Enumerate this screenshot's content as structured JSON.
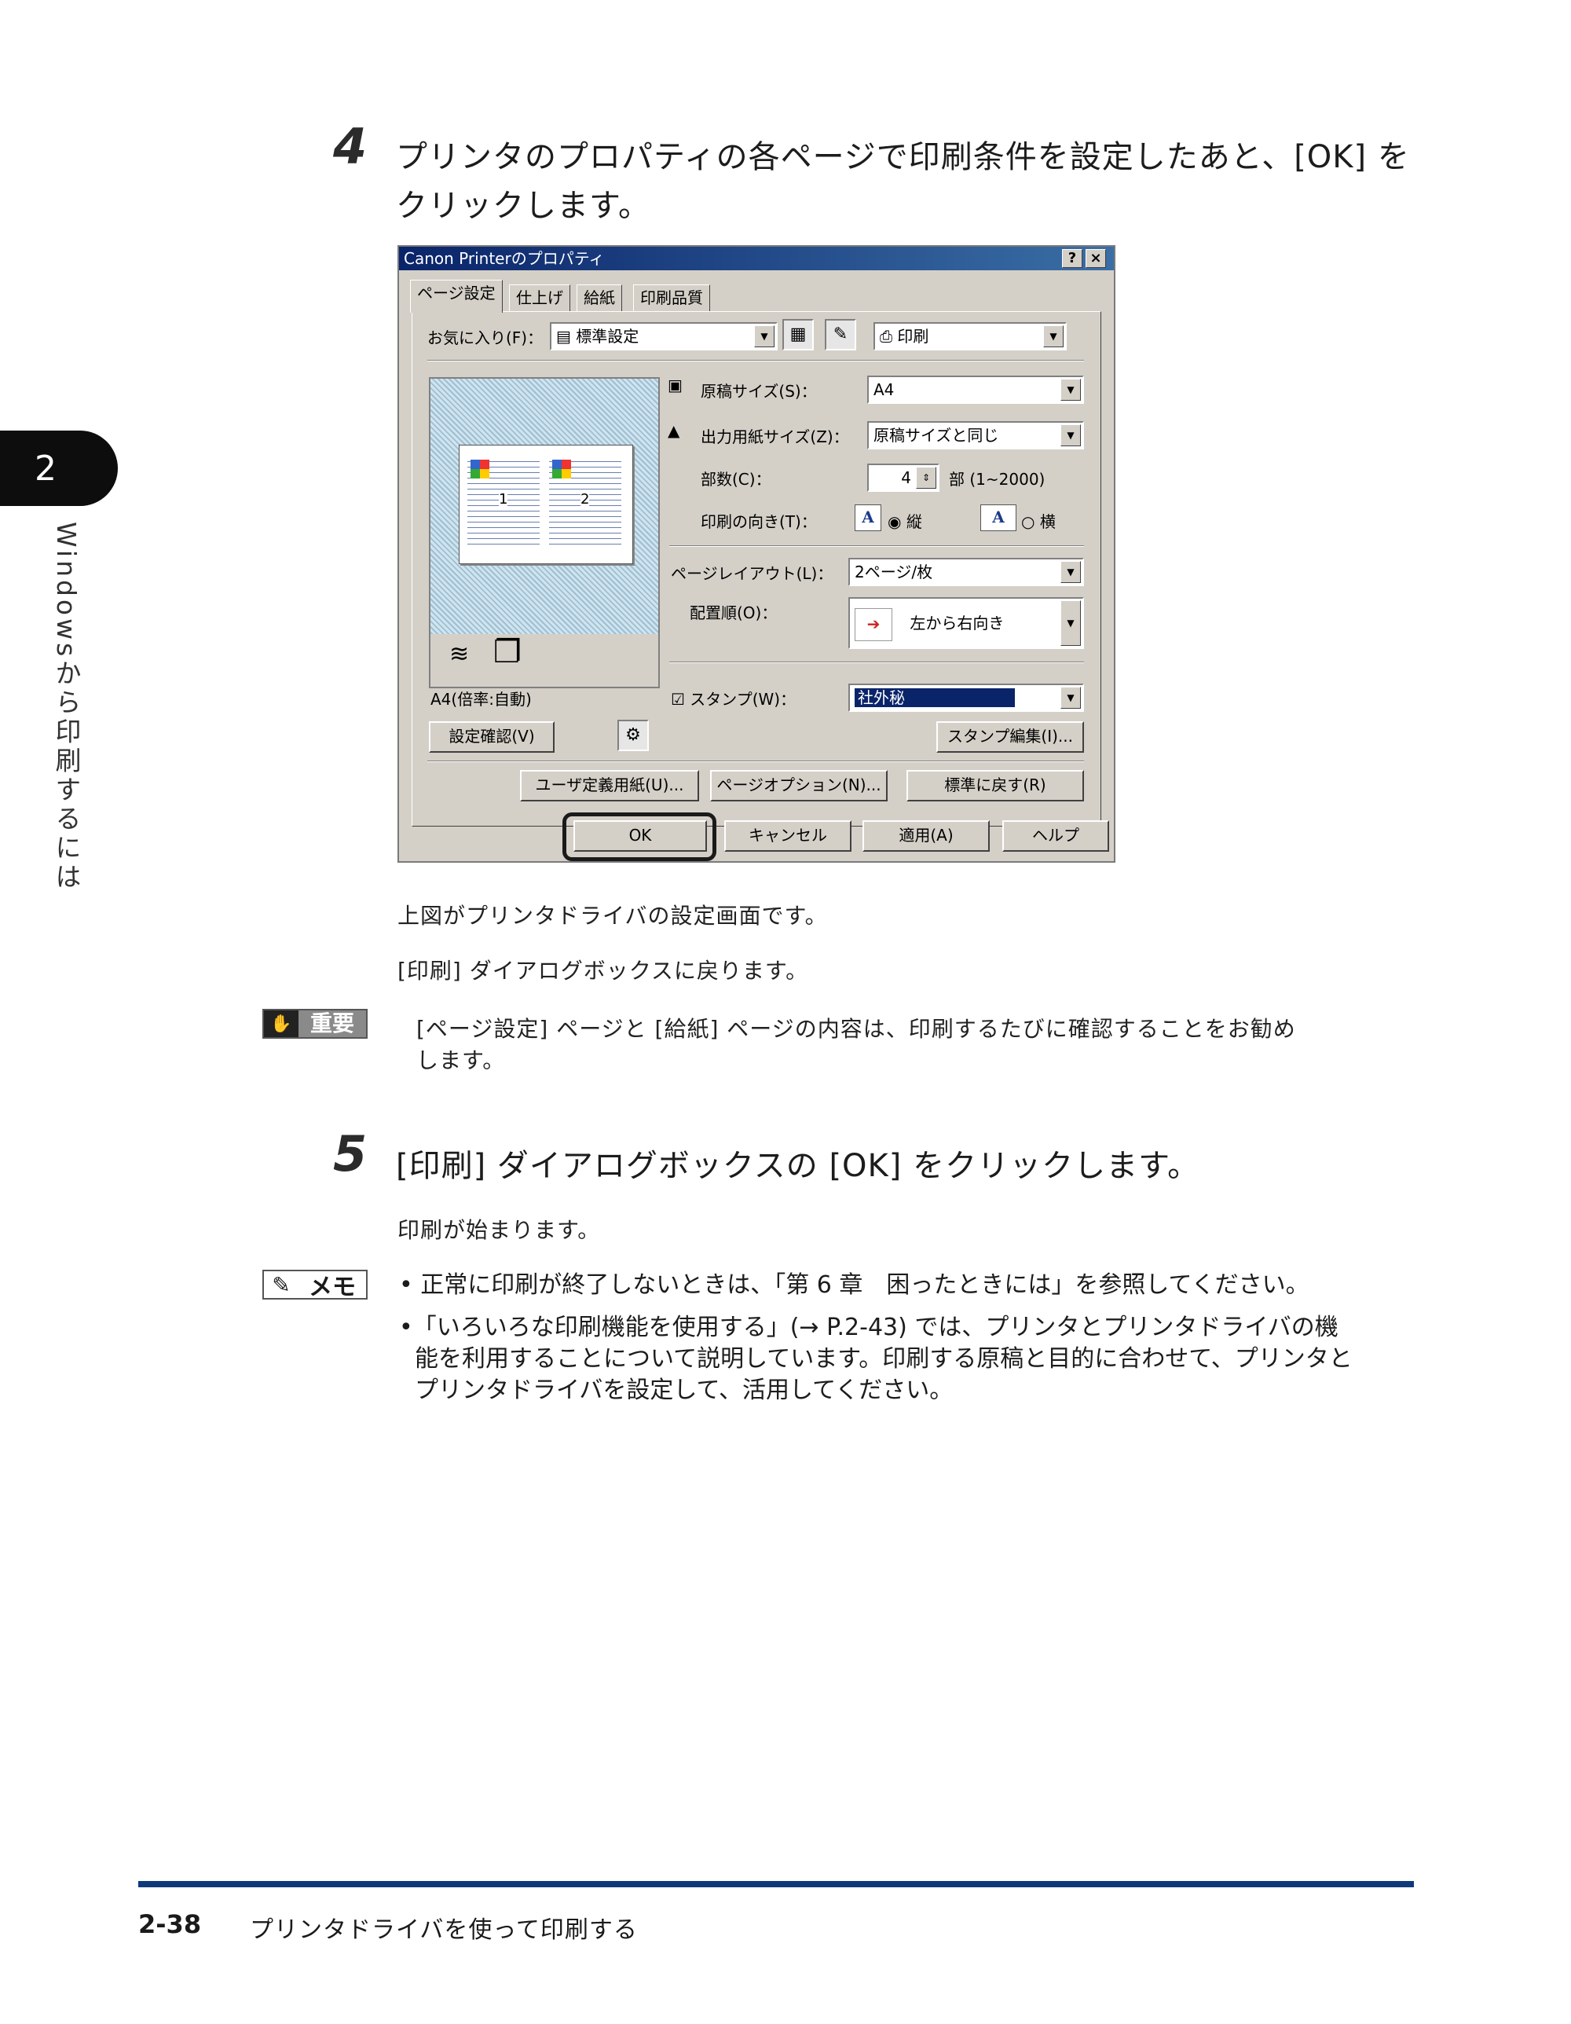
{
  "side": {
    "chapter_num": "2",
    "chapter_title": "Windowsから印刷するには"
  },
  "step4": {
    "number": "4",
    "line1": "プリンタのプロパティの各ページで印刷条件を設定したあと、[OK] を",
    "line2": "クリックします。"
  },
  "dialog": {
    "title": "Canon Printerのプロパティ",
    "help_btn": "?",
    "close_btn": "×",
    "tabs": [
      "ページ設定",
      "仕上げ",
      "給紙",
      "印刷品質"
    ],
    "favorites_label": "お気に入り(F)：",
    "favorites_value": "標準設定",
    "output_value": "印刷",
    "preview_caption": "A4(倍率:自動)",
    "orig_size_label": "原稿サイズ(S)：",
    "orig_size_value": "A4",
    "out_size_label": "出力用紙サイズ(Z)：",
    "out_size_value": "原稿サイズと同じ",
    "copies_label": "部数(C)：",
    "copies_value": "4",
    "copies_unit": "部 (1~2000)",
    "orientation_label": "印刷の向き(T)：",
    "portrait": "縦",
    "landscape": "横",
    "layout_label": "ページレイアウト(L)：",
    "layout_value": "2ページ/枚",
    "order_label": "配置順(O)：",
    "order_value": "左から右向き",
    "stamp_label": "スタンプ(W)：",
    "stamp_value": "社外秘",
    "confirm_btn": "設定確認(V)",
    "stamp_edit_btn": "スタンプ編集(I)...",
    "custom_paper_btn": "ユーザ定義用紙(U)...",
    "page_options_btn": "ページオプション(N)...",
    "restore_btn": "標準に戻す(R)",
    "ok_btn": "OK",
    "cancel_btn": "キャンセル",
    "apply_btn": "適用(A)",
    "help2_btn": "ヘルプ",
    "preview_page_1": "1",
    "preview_page_2": "2"
  },
  "caption1": "上図がプリンタドライバの設定画面です。",
  "caption2": "[印刷] ダイアログボックスに戻ります。",
  "important": {
    "label": "重要",
    "line1": "[ページ設定] ページと [給紙] ページの内容は、印刷するたびに確認することをお勧め",
    "line2": "します。"
  },
  "step5": {
    "number": "5",
    "text": "[印刷] ダイアログボックスの [OK] をクリックします。"
  },
  "caption3": "印刷が始まります。",
  "memo": {
    "label": "メモ",
    "b1": "正常に印刷が終了しないときは、「第 6 章　困ったときには」を参照してください。",
    "b2_l1": "「いろいろな印刷機能を使用する」(→ P.2-43) では、プリンタとプリンタドライバの機",
    "b2_l2": "能を利用することについて説明しています。印刷する原稿と目的に合わせて、プリンタと",
    "b2_l3": "プリンタドライバを設定して、活用してください。"
  },
  "footer": {
    "page": "2-38",
    "title": "プリンタドライバを使って印刷する"
  },
  "colors": {
    "rule": "#0e3a7a",
    "titlebar": "#0a246a",
    "dialog_bg": "#d4d0c8"
  }
}
